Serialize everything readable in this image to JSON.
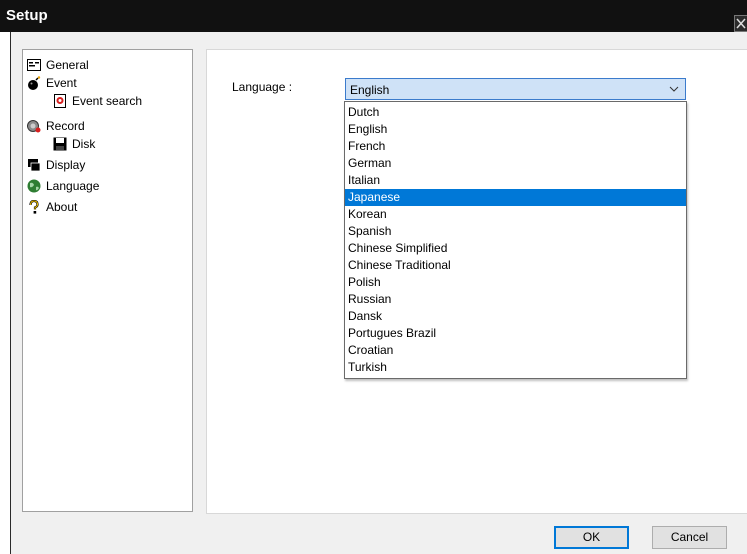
{
  "window": {
    "title": "Setup"
  },
  "tree": {
    "items": [
      {
        "label": "General",
        "icon": "general-icon",
        "indent": 0
      },
      {
        "label": "Event",
        "icon": "bomb-icon",
        "indent": 0
      },
      {
        "label": "Event search",
        "icon": "event-search-icon",
        "indent": 1
      },
      {
        "label": "Record",
        "icon": "record-icon",
        "indent": 0
      },
      {
        "label": "Disk",
        "icon": "floppy-disk-icon",
        "indent": 1
      },
      {
        "label": "Display",
        "icon": "display-icon",
        "indent": 0
      },
      {
        "label": "Language",
        "icon": "globe-icon",
        "indent": 0
      },
      {
        "label": "About",
        "icon": "question-icon",
        "indent": 0
      }
    ]
  },
  "language": {
    "label": "Language :",
    "selected": "English",
    "highlighted": "Japanese",
    "options": [
      "Dutch",
      "English",
      "French",
      "German",
      "Italian",
      "Japanese",
      "Korean",
      "Spanish",
      "Chinese Simplified",
      "Chinese Traditional",
      "Polish",
      "Russian",
      "Dansk",
      "Portugues Brazil",
      "Croatian",
      "Turkish"
    ]
  },
  "buttons": {
    "ok": "OK",
    "cancel": "Cancel"
  },
  "colors": {
    "titlebar": "#111111",
    "selection": "#0078d7",
    "combo_bg": "#cfe2f7"
  }
}
